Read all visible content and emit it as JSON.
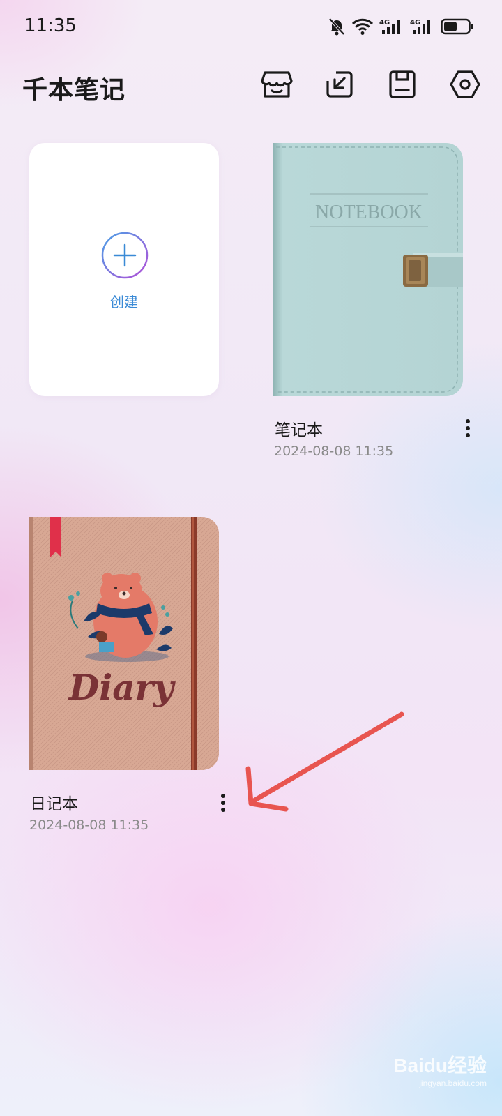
{
  "status_bar": {
    "time": "11:35",
    "icons": [
      "bell-mute-icon",
      "wifi-icon",
      "signal-4g-icon",
      "signal-4g-icon",
      "battery-icon"
    ],
    "network_labels": [
      "4G",
      "4G"
    ]
  },
  "header": {
    "title": "千本笔记",
    "actions": [
      "store-icon",
      "import-icon",
      "save-icon",
      "settings-icon"
    ]
  },
  "create_card": {
    "label": "创建",
    "icon": "plus-icon"
  },
  "notebooks": [
    {
      "name": "笔记本",
      "date": "2024-08-08 11:35",
      "cover_text": "NOTEBOOK",
      "cover_color": "#b9d8d8"
    },
    {
      "name": "日记本",
      "date": "2024-08-08 11:35",
      "cover_text": "Diary",
      "cover_color": "#d8a894"
    }
  ],
  "annotation": {
    "arrow_color": "#e85550"
  },
  "watermark": {
    "logo": "Baidu经验",
    "sub": "jingyan.baidu.com"
  }
}
